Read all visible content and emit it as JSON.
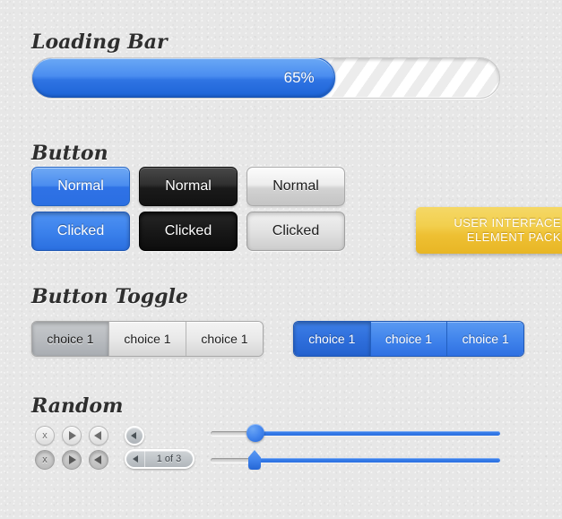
{
  "page": {
    "background_color": "#e7e7e7",
    "accent_blue": "#2f72e6",
    "accent_yellow": "#eec033"
  },
  "sections": {
    "loading_bar": {
      "heading": "Loading Bar",
      "progress_label": "65%",
      "progress_percent": 65
    },
    "button": {
      "heading": "Button",
      "rows": [
        {
          "blue": "Normal",
          "black": "Normal",
          "gray": "Normal"
        },
        {
          "blue": "Clicked",
          "black": "Clicked",
          "gray": "Clicked"
        }
      ]
    },
    "button_toggle": {
      "heading": "Button Toggle",
      "gray_group": {
        "segments": [
          "choice 1",
          "choice 1",
          "choice 1"
        ],
        "selected_index": 0
      },
      "blue_group": {
        "segments": [
          "choice 1",
          "choice 1",
          "choice 1"
        ],
        "selected_index": 0
      }
    },
    "random": {
      "heading": "Random",
      "mini_buttons": {
        "row_normal": [
          "x-icon",
          "play-icon",
          "previous-icon"
        ],
        "row_pressed": [
          "x-icon",
          "play-icon",
          "previous-icon"
        ],
        "x_label": "x"
      },
      "pager": {
        "label": "1 of 3",
        "current_page": 1,
        "total_pages": 3
      },
      "sliders": [
        {
          "style": "round-knob",
          "value_percent": 16
        },
        {
          "style": "triangle-knob",
          "value_percent": 16
        }
      ]
    }
  },
  "badge": {
    "line1": "USER INTERFACE",
    "line2": "ELEMENT PACK"
  }
}
